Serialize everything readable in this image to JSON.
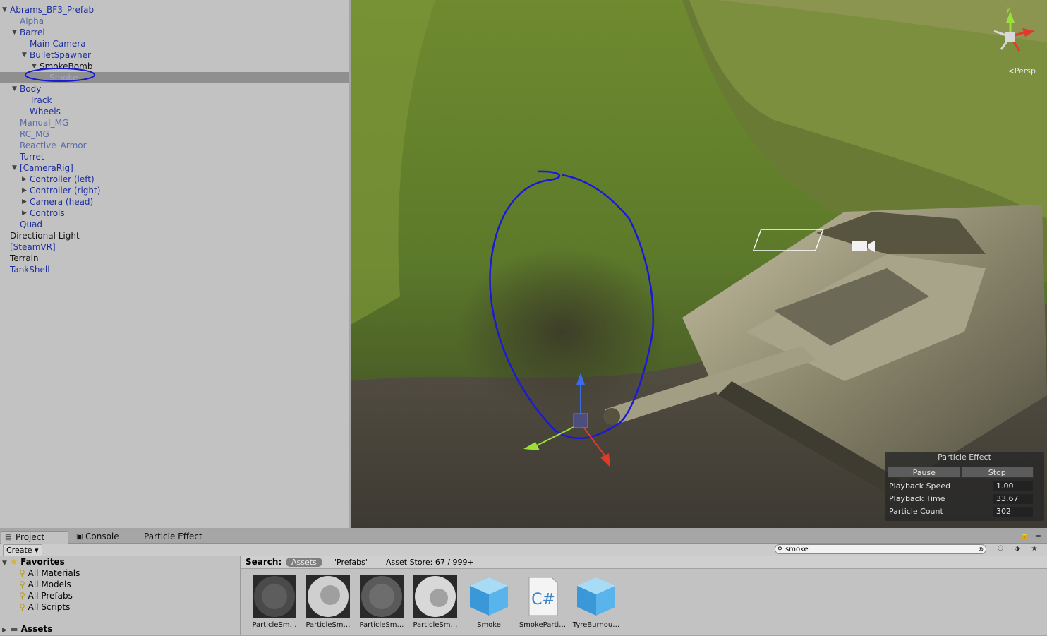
{
  "hierarchy": {
    "items": [
      {
        "label": "Abrams_BF3_Prefab",
        "expanded": true
      },
      {
        "label": "Alpha"
      },
      {
        "label": "Barrel",
        "expanded": true
      },
      {
        "label": "Main Camera"
      },
      {
        "label": "BulletSpawner",
        "expanded": true
      },
      {
        "label": "SmokeBomb",
        "expanded": true
      },
      {
        "label": "Smoke",
        "selected": true
      },
      {
        "label": "Body",
        "expanded": true
      },
      {
        "label": "Track"
      },
      {
        "label": "Wheels"
      },
      {
        "label": "Manual_MG"
      },
      {
        "label": "RC_MG"
      },
      {
        "label": "Reactive_Armor"
      },
      {
        "label": "Turret"
      },
      {
        "label": "[CameraRig]",
        "expanded": true
      },
      {
        "label": "Controller (left)",
        "expanded": false
      },
      {
        "label": "Controller (right)",
        "expanded": false
      },
      {
        "label": "Camera (head)",
        "expanded": false
      },
      {
        "label": "Controls",
        "expanded": false
      },
      {
        "label": "Quad"
      },
      {
        "label": "Directional Light"
      },
      {
        "label": "[SteamVR]"
      },
      {
        "label": "Terrain"
      },
      {
        "label": "TankShell"
      }
    ]
  },
  "scene": {
    "projection_label": "<Persp",
    "gizmo_axis_label": "y",
    "annotation_color": "#1a1ad6"
  },
  "particle_effect": {
    "title": "Particle Effect",
    "pause_label": "Pause",
    "stop_label": "Stop",
    "rows": [
      {
        "label": "Playback Speed",
        "value": "1.00"
      },
      {
        "label": "Playback Time",
        "value": "33.67"
      },
      {
        "label": "Particle Count",
        "value": "302"
      }
    ]
  },
  "bottom": {
    "tabs": [
      "Project",
      "Console",
      "Particle Effect"
    ],
    "create_label": "Create",
    "search_value": "smoke",
    "favorites_label": "Favorites",
    "favorites": [
      "All Materials",
      "All Models",
      "All Prefabs",
      "All Scripts"
    ],
    "assets_label": "Assets",
    "search_label": "Search:",
    "search_scopes": [
      "Assets",
      "'Prefabs'",
      "Asset Store: 67 / 999+"
    ],
    "assets": [
      {
        "name": "ParticleSm…",
        "kind": "texture-dark"
      },
      {
        "name": "ParticleSm…",
        "kind": "texture-light"
      },
      {
        "name": "ParticleSm…",
        "kind": "texture-dark"
      },
      {
        "name": "ParticleSm…",
        "kind": "texture-light"
      },
      {
        "name": "Smoke",
        "kind": "prefab-cube"
      },
      {
        "name": "SmokeParti…",
        "kind": "csharp-script"
      },
      {
        "name": "TyreBurnou…",
        "kind": "prefab-cube"
      }
    ]
  }
}
